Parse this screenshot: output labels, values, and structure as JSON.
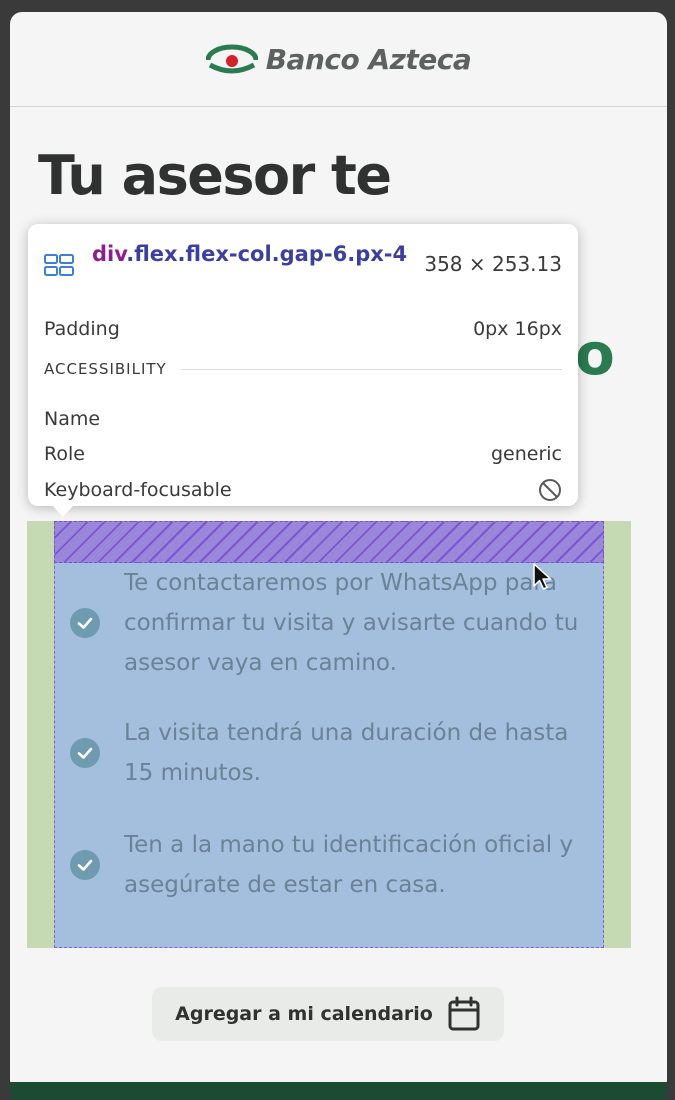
{
  "header": {
    "brand_name": "Banco Azteca"
  },
  "page": {
    "title": "Tu asesor te",
    "title_overflow_char": "o"
  },
  "devtools_tooltip": {
    "element_tag": "div",
    "element_classes": ".flex.flex-col.gap-6.px-4",
    "size": "358 × 253.13",
    "padding_label": "Padding",
    "padding_value": "0px 16px",
    "accessibility_heading": "ACCESSIBILITY",
    "name_label": "Name",
    "name_value": "",
    "role_label": "Role",
    "role_value": "generic",
    "focusable_label": "Keyboard-focusable",
    "focusable_icon": "not-allowed-icon"
  },
  "info_list": {
    "items": [
      {
        "text": "Te contactaremos por WhatsApp para confirmar tu visita y avisarte cuando tu asesor vaya en camino.",
        "icon": "check-circle-icon"
      },
      {
        "text": "La visita tendrá una duración de hasta 15 minutos.",
        "icon": "check-circle-icon"
      },
      {
        "text": "Ten a la mano tu identificación oficial y asegúrate de estar en casa.",
        "icon": "check-circle-icon"
      }
    ]
  },
  "actions": {
    "add_calendar_label": "Agregar a mi calendario",
    "add_calendar_icon": "calendar-icon"
  },
  "colors": {
    "brand_green": "#2b7a50",
    "content_highlight": "#a3bfdd",
    "padding_highlight": "#c5d9b2",
    "gap_highlight": "#9b87d9"
  }
}
